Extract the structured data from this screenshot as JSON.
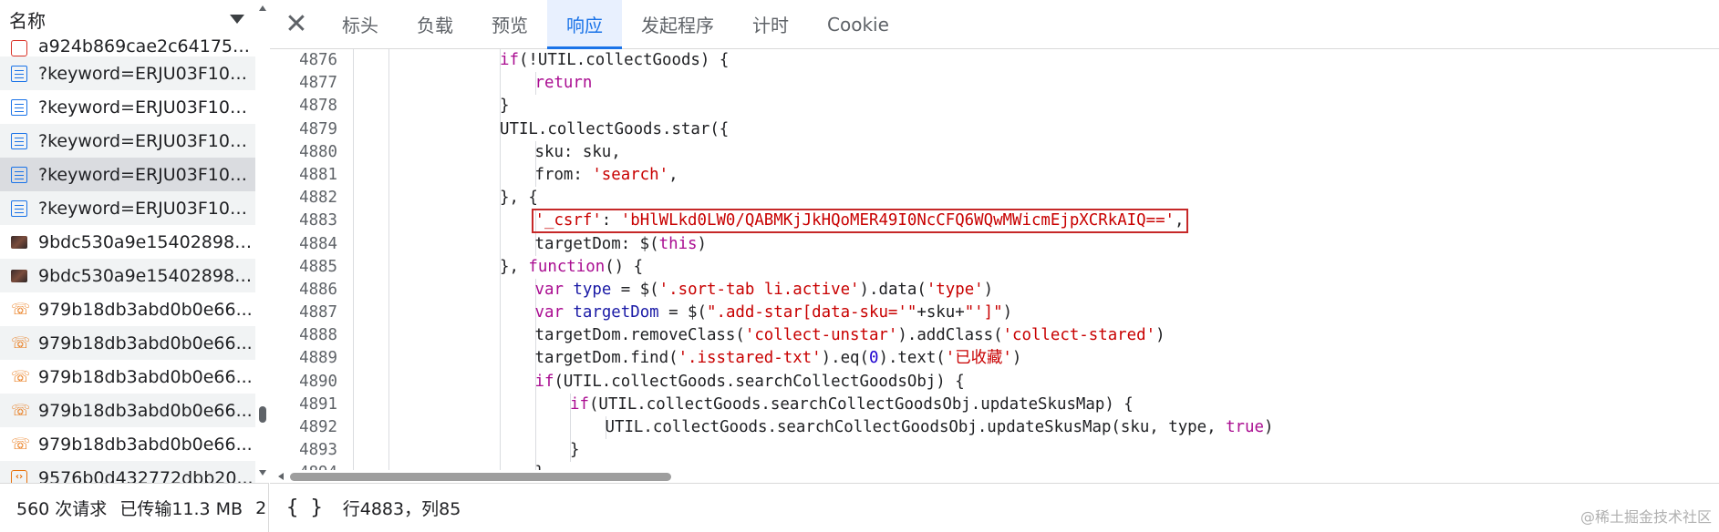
{
  "request_list": {
    "column_title": "名称",
    "items": [
      {
        "name": "a924b869cae2c641751...",
        "icon": "css-file-icon",
        "partial": true
      },
      {
        "name": "?keyword=ERJU03F100...",
        "icon": "document-icon"
      },
      {
        "name": "?keyword=ERJU03F100...",
        "icon": "document-icon"
      },
      {
        "name": "?keyword=ERJU03F100...",
        "icon": "document-icon"
      },
      {
        "name": "?keyword=ERJU03F100...",
        "icon": "document-icon",
        "selected": true
      },
      {
        "name": "?keyword=ERJU03F100...",
        "icon": "document-icon"
      },
      {
        "name": "9bdc530a9e15402898e...",
        "icon": "image-icon"
      },
      {
        "name": "9bdc530a9e15402898e...",
        "icon": "image-icon"
      },
      {
        "name": "979b18db3abd0b0e66...",
        "icon": "xhr-icon"
      },
      {
        "name": "979b18db3abd0b0e66...",
        "icon": "xhr-icon"
      },
      {
        "name": "979b18db3abd0b0e66...",
        "icon": "xhr-icon"
      },
      {
        "name": "979b18db3abd0b0e66...",
        "icon": "xhr-icon"
      },
      {
        "name": "979b18db3abd0b0e66...",
        "icon": "xhr-icon"
      },
      {
        "name": "9576b0d432772dbb20...",
        "icon": "script-icon"
      }
    ],
    "status": {
      "requests": "560 次请求",
      "transferred": "已传输11.3 MB",
      "extra": "2"
    }
  },
  "tabs": [
    {
      "label": "标头",
      "active": false
    },
    {
      "label": "负载",
      "active": false
    },
    {
      "label": "预览",
      "active": false
    },
    {
      "label": "响应",
      "active": true
    },
    {
      "label": "发起程序",
      "active": false
    },
    {
      "label": "计时",
      "active": false
    },
    {
      "label": "Cookie",
      "active": false
    }
  ],
  "code_lines": [
    {
      "n": "4876",
      "indent": 2,
      "tokens": [
        [
          "kw",
          "if"
        ],
        [
          "",
          "(!UTIL.collectGoods) {"
        ]
      ]
    },
    {
      "n": "4877",
      "indent": 3,
      "tokens": [
        [
          "kw",
          "return"
        ]
      ]
    },
    {
      "n": "4878",
      "indent": 2,
      "tokens": [
        [
          "",
          "}"
        ]
      ]
    },
    {
      "n": "4879",
      "indent": 2,
      "tokens": [
        [
          "",
          "UTIL.collectGoods.star({"
        ]
      ]
    },
    {
      "n": "4880",
      "indent": 3,
      "tokens": [
        [
          "",
          "sku: sku,"
        ]
      ]
    },
    {
      "n": "4881",
      "indent": 3,
      "tokens": [
        [
          "",
          "from: "
        ],
        [
          "str",
          "'search'"
        ],
        [
          "",
          ","
        ]
      ]
    },
    {
      "n": "4882",
      "indent": 2,
      "tokens": [
        [
          "",
          "}, {"
        ]
      ]
    },
    {
      "n": "4883",
      "indent": 3,
      "tokens": [
        [
          "str",
          "'_csrf'"
        ],
        [
          "",
          ": "
        ],
        [
          "str",
          "'bHlWLkd0LW0/QABMKjJkHQoMER49I0NcCFQ6WQwMWicmEjpXCRkAIQ=='"
        ],
        [
          "",
          ","
        ]
      ],
      "highlight": true
    },
    {
      "n": "4884",
      "indent": 3,
      "tokens": [
        [
          "",
          "targetDom: $("
        ],
        [
          "kw",
          "this"
        ],
        [
          "",
          ")"
        ]
      ]
    },
    {
      "n": "4885",
      "indent": 2,
      "tokens": [
        [
          "",
          "}, "
        ],
        [
          "kw",
          "function"
        ],
        [
          "",
          "() {"
        ]
      ]
    },
    {
      "n": "4886",
      "indent": 3,
      "tokens": [
        [
          "kw",
          "var"
        ],
        [
          "",
          " "
        ],
        [
          "blue",
          "type"
        ],
        [
          "",
          " = $("
        ],
        [
          "str",
          "'.sort-tab li.active'"
        ],
        [
          "",
          ").data("
        ],
        [
          "str",
          "'type'"
        ],
        [
          "",
          ")"
        ]
      ]
    },
    {
      "n": "4887",
      "indent": 3,
      "tokens": [
        [
          "kw",
          "var"
        ],
        [
          "",
          " "
        ],
        [
          "blue",
          "targetDom"
        ],
        [
          "",
          " = $("
        ],
        [
          "str",
          "\".add-star[data-sku='\""
        ],
        [
          "",
          "+sku+"
        ],
        [
          "str",
          "\"']\""
        ],
        [
          "",
          ")"
        ]
      ]
    },
    {
      "n": "4888",
      "indent": 3,
      "tokens": [
        [
          "",
          "targetDom.removeClass("
        ],
        [
          "str",
          "'collect-unstar'"
        ],
        [
          "",
          ").addClass("
        ],
        [
          "str",
          "'collect-stared'"
        ],
        [
          "",
          ")"
        ]
      ]
    },
    {
      "n": "4889",
      "indent": 3,
      "tokens": [
        [
          "",
          "targetDom.find("
        ],
        [
          "str",
          "'.isstared-txt'"
        ],
        [
          "",
          ").eq("
        ],
        [
          "num",
          "0"
        ],
        [
          "",
          ").text("
        ],
        [
          "str",
          "'已收藏'"
        ],
        [
          "",
          ")"
        ]
      ]
    },
    {
      "n": "4890",
      "indent": 3,
      "tokens": [
        [
          "kw",
          "if"
        ],
        [
          "",
          "(UTIL.collectGoods.searchCollectGoodsObj) {"
        ]
      ]
    },
    {
      "n": "4891",
      "indent": 4,
      "tokens": [
        [
          "kw",
          "if"
        ],
        [
          "",
          "(UTIL.collectGoods.searchCollectGoodsObj.updateSkusMap) {"
        ]
      ]
    },
    {
      "n": "4892",
      "indent": 5,
      "tokens": [
        [
          "",
          "UTIL.collectGoods.searchCollectGoodsObj.updateSkusMap(sku, type, "
        ],
        [
          "kw",
          "true"
        ],
        [
          "",
          ")"
        ]
      ]
    },
    {
      "n": "4893",
      "indent": 4,
      "tokens": [
        [
          "",
          "}"
        ]
      ]
    },
    {
      "n": "4894",
      "indent": 3,
      "tokens": [
        [
          "",
          "}"
        ]
      ],
      "partial": true
    }
  ],
  "status_bar": {
    "braces": "{ }",
    "position": "行4883，列85"
  },
  "watermark": "@稀土掘金技术社区"
}
